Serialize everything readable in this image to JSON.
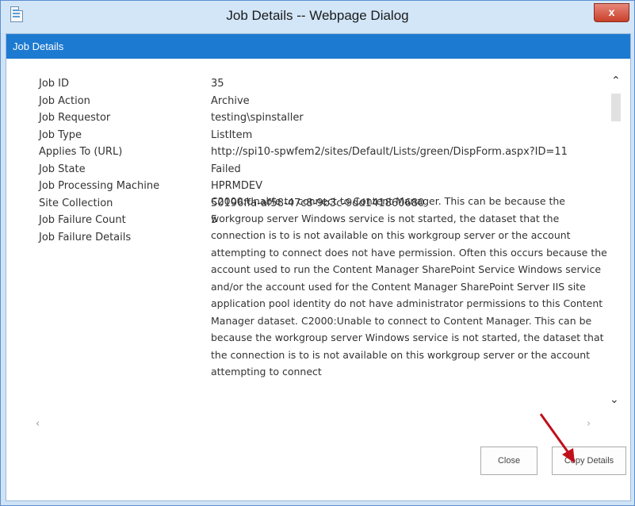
{
  "window": {
    "title": "Job Details -- Webpage Dialog",
    "close_glyph": "x"
  },
  "header": {
    "title": "Job Details"
  },
  "details": {
    "rows": [
      {
        "label": "Job ID",
        "value": "35"
      },
      {
        "label": "Job Action",
        "value": "Archive"
      },
      {
        "label": "Job Requestor",
        "value": "testing\\spinstaller"
      },
      {
        "label": "Job Type",
        "value": "ListItem"
      },
      {
        "label": "Applies To (URL)",
        "value": "http://spi10-spwfem2/sites/Default/Lists/green/DispForm.aspx?ID=11"
      },
      {
        "label": "Job State",
        "value": "Failed"
      },
      {
        "label": "Job Processing Machine",
        "value": "HPRMDEV"
      },
      {
        "label": "Site Collection",
        "value": "50196ffa-af58-47c8-9b3c-9dd141860680"
      },
      {
        "label": "Job Failure Count",
        "value": "5"
      }
    ],
    "failure_label": "Job Failure Details",
    "failure_text": "C2000:Unable to connect to  Content Manager. This can be because the workgroup server Windows service is not started, the dataset that the connection is to is not available on this workgroup server or the account attempting to connect does not have permission. Often this occurs because the account used to run the Content Manager SharePoint Service Windows service and/or the account used for the  Content Manager SharePoint Server IIS site application pool identity do not have administrator permissions to this Content Manager dataset. C2000:Unable to connect to  Content Manager. This can be because the workgroup server Windows service is not started, the dataset that the connection is to is not available on this workgroup server or the account attempting to connect"
  },
  "buttons": {
    "close_label": "Close",
    "copy_label": "Copy Details"
  },
  "colors": {
    "header_blue": "#1d7ad1",
    "titlebar": "#d3e6f8",
    "close_red": "#c8402a",
    "annotation_arrow": "#c0101a"
  },
  "icons": {
    "app": "document-icon",
    "scroll_up": "chevron-up-icon",
    "scroll_down": "chevron-down-icon",
    "scroll_left": "chevron-left-icon",
    "scroll_right": "chevron-right-icon"
  }
}
